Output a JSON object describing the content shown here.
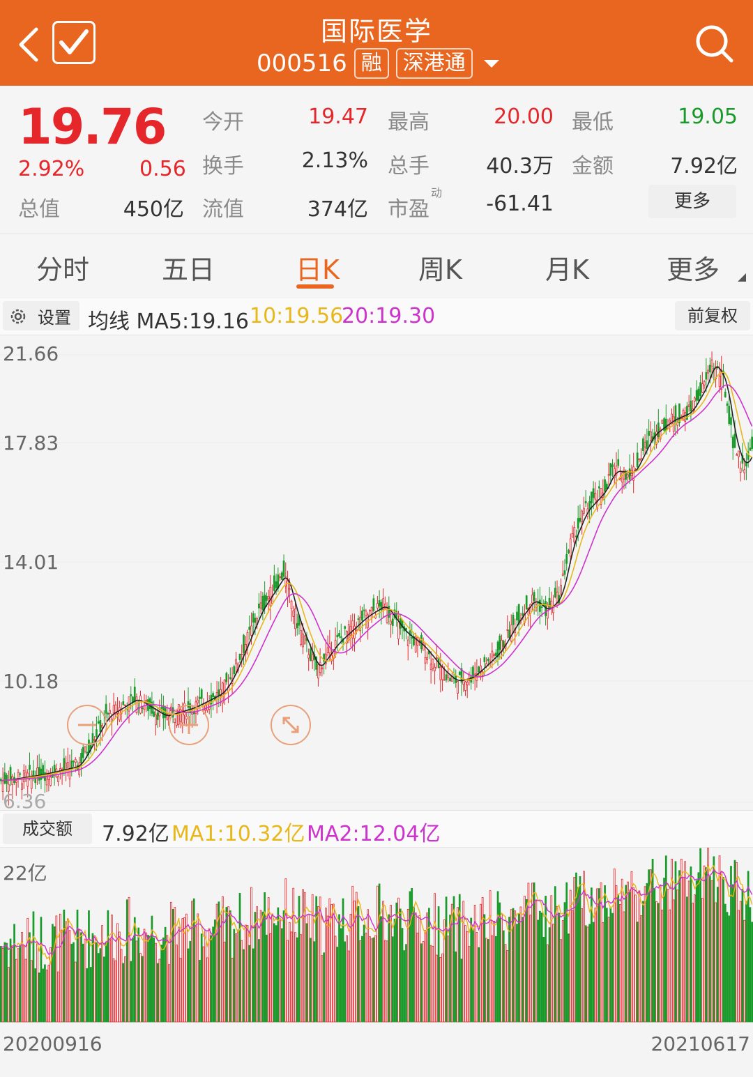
{
  "header": {
    "title": "国际医学",
    "code": "000516",
    "tag_margin": "融",
    "tag_connect": "深港通",
    "icons": [
      "back-icon",
      "checkbox-icon",
      "dropdown-icon",
      "search-icon"
    ]
  },
  "quote": {
    "price": "19.76",
    "change_pct": "2.92%",
    "change": "0.56",
    "open_label": "今开",
    "open": "19.47",
    "high_label": "最高",
    "high": "20.00",
    "low_label": "最低",
    "low": "19.05",
    "turnover_label": "换手",
    "turnover": "2.13%",
    "volume_label": "总手",
    "volume": "40.3万",
    "amount_label": "金额",
    "amount": "7.92亿",
    "mktcap_label": "总值",
    "mktcap": "450亿",
    "float_label": "流值",
    "float": "374亿",
    "pe_label": "市盈",
    "pe_sup": "动",
    "pe": "-61.41",
    "more": "更多"
  },
  "tabs": [
    "分时",
    "五日",
    "日K",
    "周K",
    "月K",
    "更多"
  ],
  "active_tab": "日K",
  "ma_bar": {
    "settings": "设置",
    "ma5": "均线 MA5:19.16",
    "ma10": "10:19.56",
    "ma20": "20:19.30",
    "adjust": "前复权"
  },
  "volume_bar": {
    "label": "成交额",
    "value": "7.92亿",
    "ma1": "MA1:10.32亿",
    "ma2": "MA2:12.04亿",
    "top_label": "22亿"
  },
  "chart_data": {
    "type": "candlestick",
    "price_axis_labels": [
      "21.66",
      "17.83",
      "14.01",
      "10.18",
      "6.36"
    ],
    "ylim": [
      6.36,
      21.66
    ],
    "x_start": "20200916",
    "x_end": "20210617",
    "colors": {
      "up": "#e5262b",
      "down": "#1a9a2a",
      "ma5": "#222222",
      "ma10": "#e8b71a",
      "ma20": "#cc33cc"
    },
    "close_path": [
      [
        0,
        7.1
      ],
      [
        20,
        7.3
      ],
      [
        40,
        7.6
      ],
      [
        55,
        9.3
      ],
      [
        70,
        9.9
      ],
      [
        85,
        9.3
      ],
      [
        100,
        9.6
      ],
      [
        115,
        10.1
      ],
      [
        120,
        10.6
      ],
      [
        128,
        11.8
      ],
      [
        135,
        12.9
      ],
      [
        142,
        13.6
      ],
      [
        148,
        14.2
      ],
      [
        155,
        12.5
      ],
      [
        165,
        10.9
      ],
      [
        175,
        11.8
      ],
      [
        190,
        12.7
      ],
      [
        200,
        13.1
      ],
      [
        210,
        12.2
      ],
      [
        220,
        11.7
      ],
      [
        230,
        10.9
      ],
      [
        237,
        10.5
      ],
      [
        245,
        10.6
      ],
      [
        252,
        11.0
      ],
      [
        260,
        11.5
      ],
      [
        270,
        12.6
      ],
      [
        278,
        13.3
      ],
      [
        285,
        12.9
      ],
      [
        292,
        13.4
      ],
      [
        298,
        15.2
      ],
      [
        305,
        16.3
      ],
      [
        315,
        17.0
      ],
      [
        320,
        17.7
      ],
      [
        330,
        17.6
      ],
      [
        340,
        18.9
      ],
      [
        350,
        19.4
      ],
      [
        360,
        19.7
      ],
      [
        368,
        20.6
      ],
      [
        372,
        21.4
      ],
      [
        378,
        20.8
      ],
      [
        383,
        18.7
      ],
      [
        388,
        17.8
      ],
      [
        393,
        18.4
      ]
    ],
    "volume_ylim": [
      0,
      22
    ]
  },
  "controls": [
    "zoom-out-icon",
    "zoom-in-icon",
    "fullscreen-icon"
  ]
}
